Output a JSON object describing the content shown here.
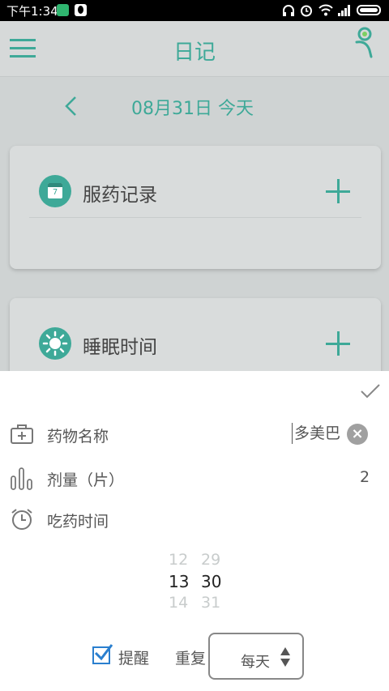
{
  "status_bar": {
    "time": "下午1:34"
  },
  "app_bar": {
    "title": "日记"
  },
  "date_nav": {
    "label": "08月31日 今天"
  },
  "cards": [
    {
      "title": "服药记录",
      "calendar_day": "7"
    },
    {
      "title": "睡眠时间"
    }
  ],
  "sheet": {
    "medicine_label": "药物名称",
    "medicine_value": "多美巴",
    "clear_glyph": "×",
    "dose_label": "剂量（片）",
    "dose_value": "2",
    "time_label": "吃药时间",
    "picker": {
      "hours": [
        "12",
        "13",
        "14"
      ],
      "minutes": [
        "29",
        "30",
        "31"
      ],
      "selected_hour": "13",
      "selected_minute": "30"
    },
    "reminder_label": "提醒",
    "reminder_checked": true,
    "repeat_label": "重复",
    "repeat_value": "每天"
  },
  "colors": {
    "accent": "#3ea998",
    "checkbox": "#2a7fcf"
  }
}
